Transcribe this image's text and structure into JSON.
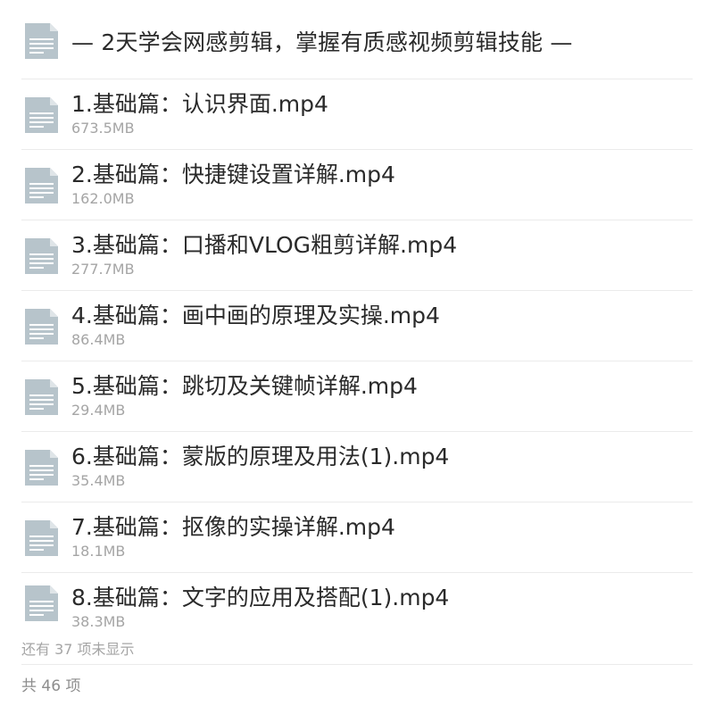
{
  "header": {
    "title": "— 2天学会网感剪辑，掌握有质感视频剪辑技能 —",
    "icon": "file-document-icon"
  },
  "files": [
    {
      "name": "1.基础篇：认识界面.mp4",
      "size": "673.5MB",
      "icon": "file-document-icon"
    },
    {
      "name": "2.基础篇：快捷键设置详解.mp4",
      "size": "162.0MB",
      "icon": "file-document-icon"
    },
    {
      "name": "3.基础篇：口播和VLOG粗剪详解.mp4",
      "size": "277.7MB",
      "icon": "file-document-icon"
    },
    {
      "name": "4.基础篇：画中画的原理及实操.mp4",
      "size": "86.4MB",
      "icon": "file-document-icon"
    },
    {
      "name": "5.基础篇：跳切及关键帧详解.mp4",
      "size": "29.4MB",
      "icon": "file-document-icon"
    },
    {
      "name": "6.基础篇：蒙版的原理及用法(1).mp4",
      "size": "35.4MB",
      "icon": "file-document-icon"
    },
    {
      "name": "7.基础篇：抠像的实操详解.mp4",
      "size": "18.1MB",
      "icon": "file-document-icon"
    },
    {
      "name": "8.基础篇：文字的应用及搭配(1).mp4",
      "size": "38.3MB",
      "icon": "file-document-icon"
    }
  ],
  "footer": {
    "more_text": "还有 37 项未显示",
    "total_text": "共 46 项"
  },
  "colors": {
    "icon_fill": "#b7c4cb",
    "icon_fold": "#dfe5e8",
    "icon_lines": "#ffffff",
    "text_primary": "#2a2a2a",
    "text_secondary": "#a5a5a5",
    "divider": "#ebebeb"
  }
}
